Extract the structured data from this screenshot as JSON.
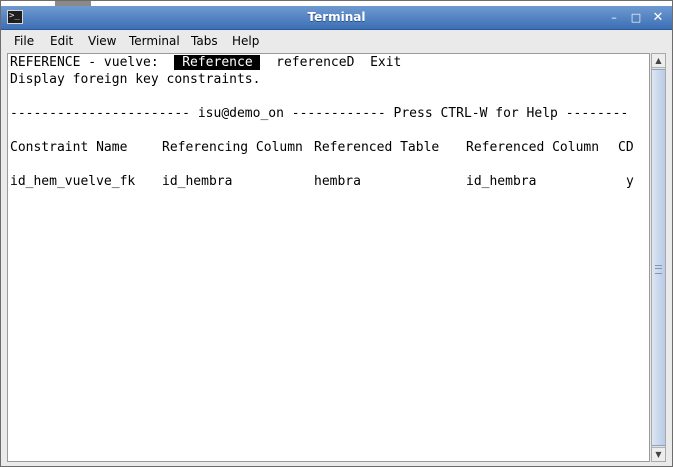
{
  "window": {
    "title": "Terminal",
    "controls": {
      "minimize": "–",
      "maximize": "□",
      "close": "✕"
    }
  },
  "menu": [
    "File",
    "Edit",
    "View",
    "Terminal",
    "Tabs",
    "Help"
  ],
  "terminal": {
    "prompt_prefix": "REFERENCE - vuelve:  ",
    "options": {
      "selected": " Reference ",
      "option2": "referenceD",
      "option3": "Exit"
    },
    "description": "Display foreign key constraints.",
    "status_line": "----------------------- isu@demo_on ------------ Press CTRL-W for Help --------",
    "headers": {
      "constraint_name": "Constraint Name",
      "referencing_column": "Referencing Column",
      "referenced_table": "Referenced Table",
      "referenced_column": "Referenced Column",
      "cd": "CD"
    },
    "rows": [
      {
        "constraint_name": "id_hem_vuelve_fk",
        "referencing_column": "id_hembra",
        "referenced_table": "hembra",
        "referenced_column": "id_hembra",
        "cd": "y"
      }
    ]
  },
  "colors": {
    "titlebar_top": "#6f9ad0",
    "titlebar_bottom": "#3c6fb5",
    "selection_bg": "#000000",
    "selection_fg": "#ffffff"
  }
}
